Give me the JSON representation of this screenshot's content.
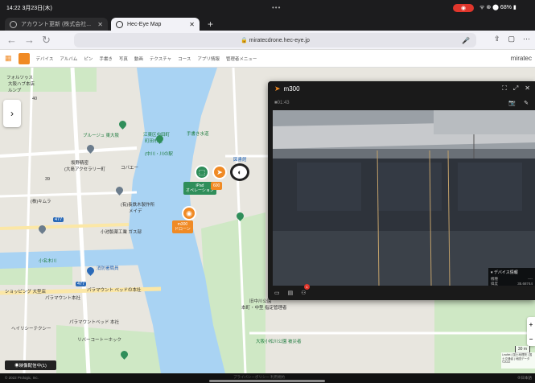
{
  "status": {
    "time": "14:22",
    "date": "3月23日(木)",
    "recording": "◉",
    "system": "ᯤ ⊛ ⬤ 68% ▮"
  },
  "tabs": [
    {
      "label": "アカウント更新 (株式会社..."
    },
    {
      "label": "Hec-Eye Map"
    }
  ],
  "url": "miratecdrone.hec-eye.jp",
  "app_nav": {
    "items": [
      "デバイス",
      "アルバム",
      "ピン",
      "手書き",
      "写真",
      "動画",
      "テクスチャ",
      "コース",
      "アプリ情報",
      "管理者メニュー"
    ],
    "brand": "miratec"
  },
  "map": {
    "labels": {
      "rakuseikai": "フォルツゥス",
      "osaka_gakuen": "大阪ハブ本店",
      "konan": "ルンプ",
      "num40": "40",
      "num39": "39",
      "brugge": "ブルージュ 東大阪",
      "koto_ward": "江東区中田町",
      "yutenji": "町田市屋",
      "tenmabashi": "手書き水道",
      "kikinogiku": "図書館",
      "nakagawa": "(中川・川の駅",
      "sakano": "坂野精密",
      "kizamon": "コバエー",
      "oshima": "(大島アクセラリー町",
      "amagasaki": "(株)キムラ",
      "nagasaki": "(有)長鉄木製作所",
      "meidi": "メイデ",
      "kobara": "小池製薬工業 ガス部",
      "kitayama": "北山",
      "ko_nagai": "小名木川",
      "fire_station": "消防署職員",
      "paramount_hotel": "パラマウント ベッドの本社",
      "shoppers": "ショッピング 大型店",
      "paramount_office": "パラマウント本社",
      "shinsaibashi": "ヘイリシーテクシー",
      "paramount_bed": "パラマウントベッド 本社",
      "river_court": "リバーコートーホック",
      "nakagawa_park": "旧中川公園",
      "hotel_list": "本町・中型 指定管理者",
      "osakakomatsu": "大阪小松川公園 被災者",
      "ipad_tag": "iPad",
      "ipad_sub": "オペレーション",
      "m300_tag": "m300",
      "m300_sub": "ドローン",
      "ipad_id": "600",
      "scale": "30 m",
      "attrib": "Leaflet | 国土地理院 | 国土交通省 | 地図データ ©2022",
      "route": "477",
      "route2": "477"
    }
  },
  "video_panel": {
    "title": "m300",
    "time": "01:43",
    "device_info": {
      "title": "▾ デバイス情報",
      "rows": [
        {
          "k": "機種",
          "v": "----"
        },
        {
          "k": "緯度",
          "v": "35.68744"
        },
        {
          "k": "経度",
          "v": "139.84152"
        },
        {
          "k": "高度",
          "v": "---"
        }
      ]
    }
  },
  "streaming": "◉映像配信中(1)",
  "bottom": {
    "copy": "© 2022 Prologic, Inc.",
    "links": "プライバシーポリシー   利用規約",
    "right": "⊕日本語"
  }
}
